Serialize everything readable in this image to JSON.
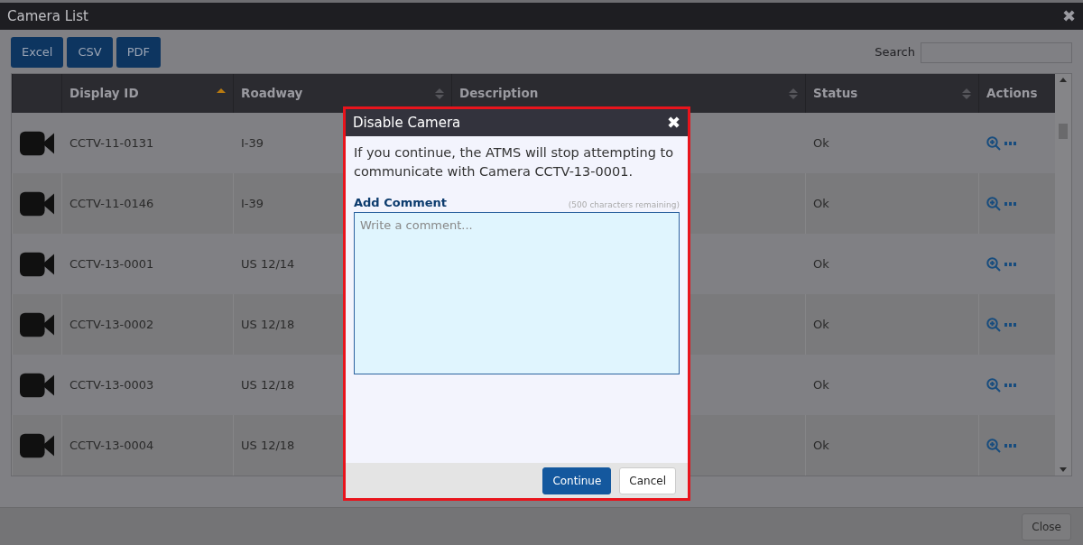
{
  "window": {
    "title": "Camera List",
    "close_label": "✖"
  },
  "export_buttons": [
    "Excel",
    "CSV",
    "PDF"
  ],
  "search": {
    "label": "Search"
  },
  "table": {
    "columns": [
      {
        "label": "Display ID",
        "sortable": true,
        "sorted": true
      },
      {
        "label": "Roadway",
        "sortable": true,
        "sorted": false
      },
      {
        "label": "Description",
        "sortable": true,
        "sorted": false
      },
      {
        "label": "Status",
        "sortable": true,
        "sorted": false
      },
      {
        "label": "Actions",
        "sortable": false,
        "sorted": false
      }
    ],
    "rows": [
      {
        "display_id": "CCTV-11-0131",
        "roadway": "I-39",
        "status": "Ok"
      },
      {
        "display_id": "CCTV-11-0146",
        "roadway": "I-39",
        "status": "Ok"
      },
      {
        "display_id": "CCTV-13-0001",
        "roadway": "US 12/14",
        "status": "Ok"
      },
      {
        "display_id": "CCTV-13-0002",
        "roadway": "US 12/18",
        "status": "Ok"
      },
      {
        "display_id": "CCTV-13-0003",
        "roadway": "US 12/18",
        "status": "Ok"
      },
      {
        "display_id": "CCTV-13-0004",
        "roadway": "US 12/18",
        "status": "Ok"
      }
    ]
  },
  "footer": {
    "close_button": "Close"
  },
  "dialog": {
    "title": "Disable Camera",
    "close_label": "✖",
    "message": "If you continue, the ATMS will stop attempting to communicate with Camera CCTV-13-0001.",
    "comment_label": "Add Comment",
    "remaining": "(500 characters remaining)",
    "placeholder": "Write a comment...",
    "buttons": [
      {
        "label": "Continue",
        "kind": "primary"
      },
      {
        "label": "Cancel",
        "kind": "secondary"
      }
    ]
  }
}
